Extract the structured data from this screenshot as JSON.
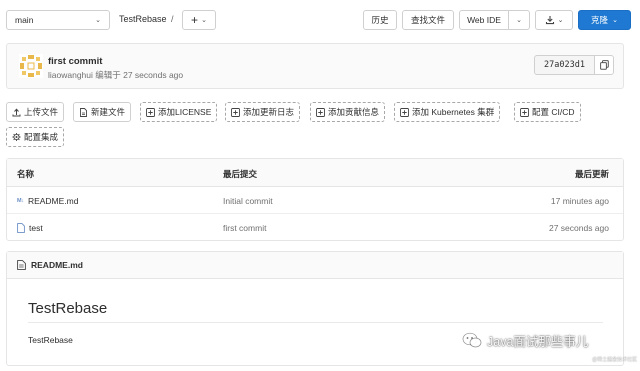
{
  "topbar": {
    "branch": "main",
    "project": "TestRebase",
    "separator": "/",
    "add_label": "+",
    "history": "历史",
    "find_file": "查找文件",
    "web_ide": "Web IDE",
    "clone": "克隆"
  },
  "commit": {
    "title": "first commit",
    "meta": "liaowanghui 编辑于 27 seconds ago",
    "sha": "27a023d1"
  },
  "actions": [
    "上传文件",
    "新建文件",
    "添加LICENSE",
    "添加更新日志",
    "添加贡献信息",
    "添加 Kubernetes 集群",
    "配置 CI/CD",
    "配置集成"
  ],
  "table": {
    "headers": [
      "名称",
      "最后提交",
      "最后更新"
    ],
    "rows": [
      {
        "name": "README.md",
        "commit": "Initial commit",
        "time": "17 minutes ago"
      },
      {
        "name": "test",
        "commit": "first commit",
        "time": "27 seconds ago"
      }
    ]
  },
  "readme": {
    "filename": "README.md",
    "heading": "TestRebase",
    "body": "TestRebase"
  },
  "watermark": {
    "text": "Java面试那些事儿",
    "sub": "@稀土掘金技术社区"
  },
  "colors": {
    "primary": "#1f78d1",
    "border": "#e5e5e5"
  }
}
